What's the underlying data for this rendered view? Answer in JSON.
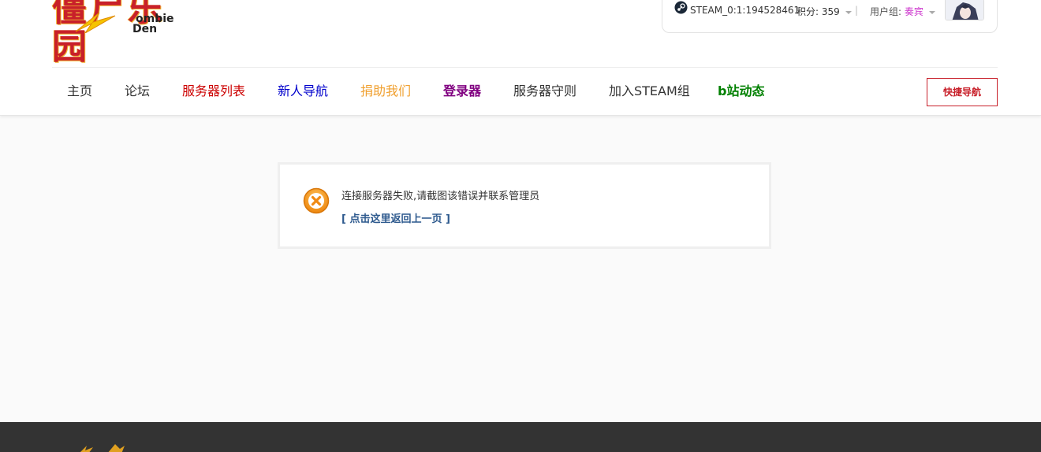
{
  "logo": {
    "chinese": "僵尸乐园",
    "english_line1": "ombie",
    "english_line2": "Den"
  },
  "user": {
    "steam_icon": "steam-icon",
    "steam_id": "STEAM_0:1:194528461",
    "points_label": "积分:",
    "points_value": "359",
    "group_label": "用户组:",
    "group_value": "奏宾",
    "separator": "|"
  },
  "nav": {
    "items": [
      {
        "label": "主页",
        "color": "#333333"
      },
      {
        "label": "论坛",
        "color": "#333333"
      },
      {
        "label": "服务器列表",
        "color": "#cc0000"
      },
      {
        "label": "新人导航",
        "color": "#0000cc"
      },
      {
        "label": "捐助我们",
        "color": "#f0a030"
      },
      {
        "label": "登录器",
        "color": "#800080"
      },
      {
        "label": "服务器守则",
        "color": "#333333"
      },
      {
        "label": "加入STEAM组",
        "color": "#333333"
      },
      {
        "label": "b站动态",
        "color": "#008000"
      }
    ],
    "quick_nav_label": "快捷导航"
  },
  "message": {
    "icon": "error-icon",
    "text": "连接服务器失败,请截图该错误并联系管理员",
    "back_link": "[ 点击这里返回上一页 ]"
  },
  "colors": {
    "brand_red": "#c8202a",
    "link_blue": "#2e5a8e",
    "footer_bg": "#333333",
    "error_orange": "#f39c12"
  }
}
